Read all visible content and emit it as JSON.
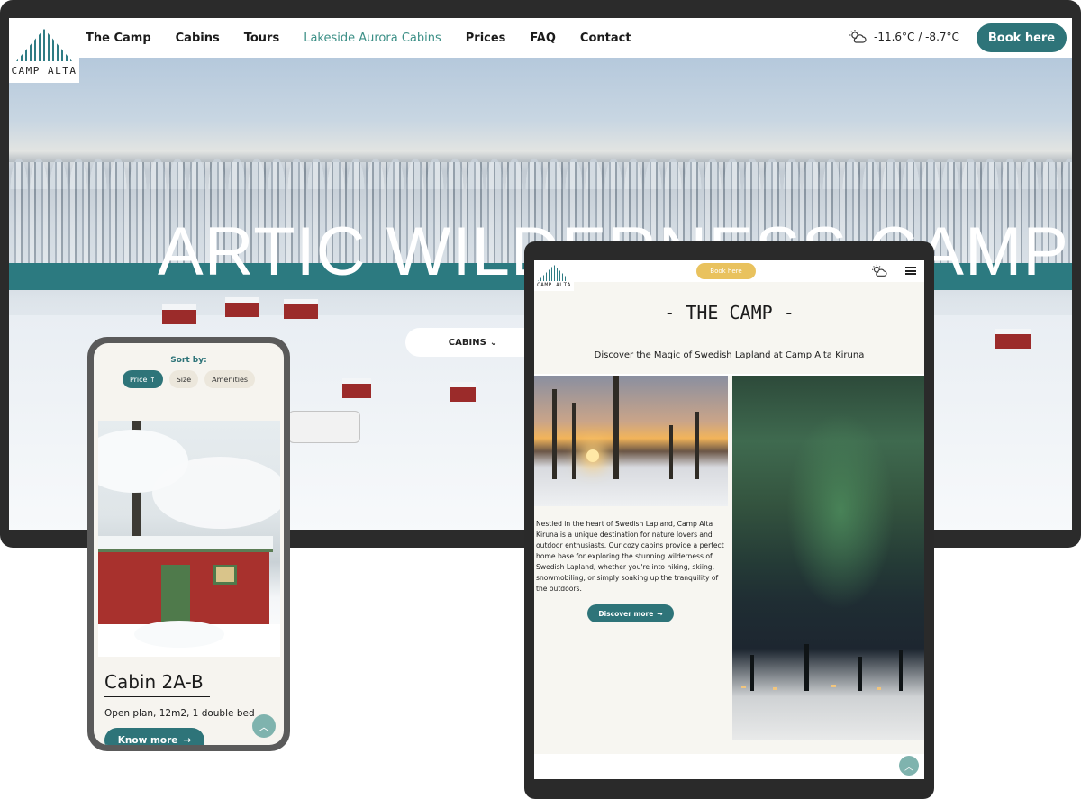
{
  "desktop": {
    "logo_text": "CAMP ALTA",
    "nav": [
      "The Camp",
      "Cabins",
      "Tours",
      "Lakeside Aurora Cabins",
      "Prices",
      "FAQ",
      "Contact"
    ],
    "active_nav_index": 3,
    "weather_icon": "cloud-sun-icon",
    "temperature": "-11.6°C / -8.7°C",
    "book_button": "Book here",
    "hero_title": "ARTIC WILDERNESS CAMP",
    "cabins_dropdown": "CABINS",
    "accent_color": "#2e7479"
  },
  "phone": {
    "sort_label": "Sort by:",
    "sort_options": [
      "Price ↑",
      "Size",
      "Amenities"
    ],
    "active_sort_index": 0,
    "cabin_name": "Cabin 2A-B",
    "cabin_description": "Open plan, 12m2, 1 double bed",
    "know_more_button": "Know more"
  },
  "tablet": {
    "logo_text": "CAMP ALTA",
    "book_button": "Book here",
    "section_title": "- THE CAMP -",
    "subtitle": "Discover the Magic of Swedish Lapland at Camp Alta Kiruna",
    "body": "Nestled in the heart of Swedish Lapland, Camp Alta Kiruna is a unique destination for nature lovers and outdoor enthusiasts. Our cozy cabins provide a perfect home base for exploring the stunning wilderness of Swedish Lapland, whether you're into hiking, skiing, snowmobiling, or simply soaking up the tranquility of the outdoors.",
    "discover_button": "Discover more",
    "book_color": "#e9c25e"
  }
}
